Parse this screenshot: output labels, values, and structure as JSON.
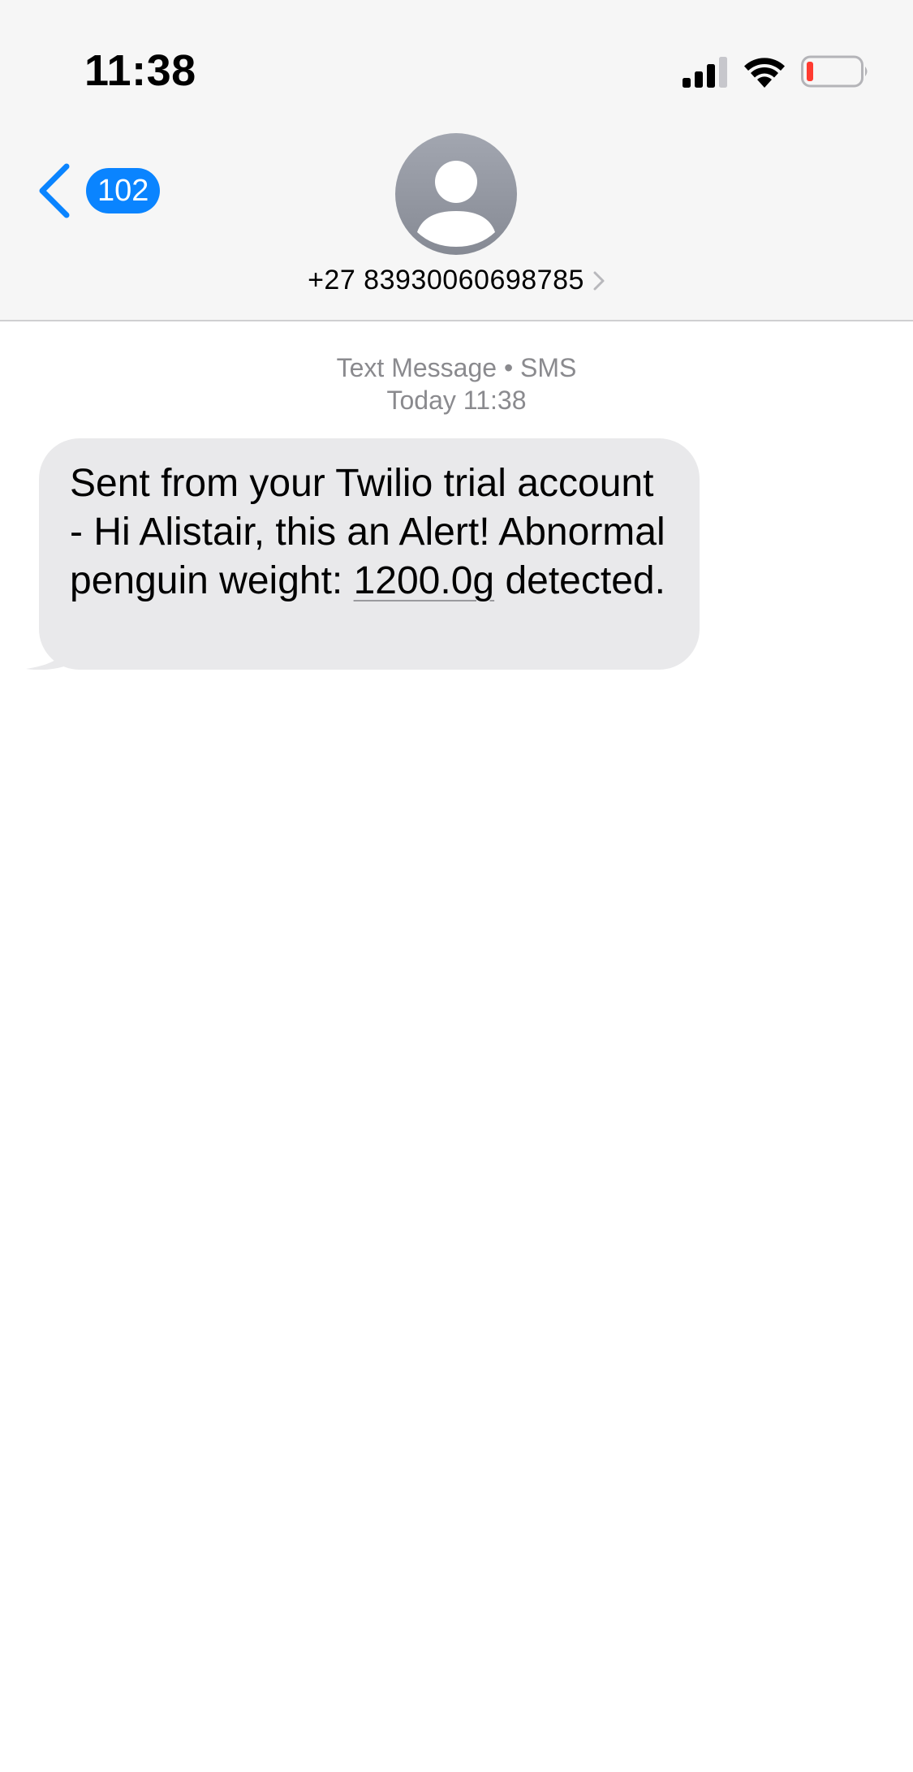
{
  "status_bar": {
    "time": "11:38",
    "icons": [
      "cellular-signal-icon",
      "wifi-icon",
      "battery-low-icon"
    ],
    "battery_color": "#ff3b30"
  },
  "nav": {
    "back_badge": "102",
    "contact_name": "+27 83930060698785",
    "accent_color": "#0a84ff",
    "icons": [
      "chevron-left-icon",
      "contact-avatar-icon",
      "chevron-right-icon"
    ]
  },
  "conversation": {
    "service_label": "Text Message • SMS",
    "timestamp": "Today 11:38",
    "messages": [
      {
        "direction": "incoming",
        "text_before": "Sent from your Twilio trial account - Hi Alistair, this an Alert! Abnormal penguin weight: ",
        "link_text": "1200.0g",
        "text_after": " detected.",
        "bubble_color": "#e9e9eb"
      }
    ]
  }
}
